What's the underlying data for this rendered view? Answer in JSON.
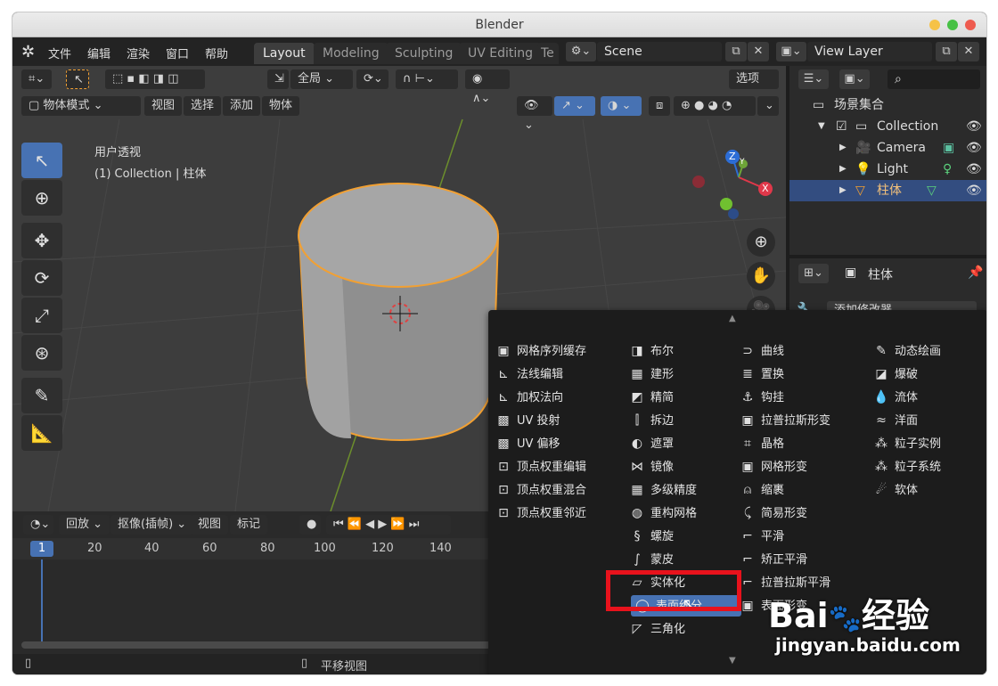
{
  "window": {
    "title": "Blender"
  },
  "topbar": {
    "menus": [
      "文件",
      "编辑",
      "渲染",
      "窗口",
      "帮助"
    ],
    "workspace_tabs": [
      "Layout",
      "Modeling",
      "Sculpting",
      "UV Editing",
      "Te"
    ],
    "scene": "Scene",
    "view_layer": "View Layer"
  },
  "viewport": {
    "transform_orientation": "全局",
    "options_label": "选项",
    "mode": "物体模式",
    "menus": [
      "视图",
      "选择",
      "添加",
      "物体"
    ],
    "overlay_title": "用户透视",
    "overlay_subtitle": "(1) Collection | 柱体",
    "gizmo_axes": {
      "z": "Z",
      "y": "Y",
      "x": "X"
    }
  },
  "outliner": {
    "scene_collection": "场景集合",
    "rows": [
      {
        "name": "Collection",
        "icon": "collection-icon"
      },
      {
        "name": "Camera",
        "icon": "camera-icon"
      },
      {
        "name": "Light",
        "icon": "light-icon"
      },
      {
        "name": "柱体",
        "icon": "mesh-icon",
        "selected": true
      }
    ]
  },
  "properties": {
    "object_name": "柱体",
    "add_modifier": "添加修改器"
  },
  "modifier_menu": {
    "columns": [
      [
        "网格序列缓存",
        "法线编辑",
        "加权法向",
        "UV 投射",
        "UV 偏移",
        "顶点权重编辑",
        "顶点权重混合",
        "顶点权重邻近"
      ],
      [
        "布尔",
        "建形",
        "精简",
        "拆边",
        "遮罩",
        "镜像",
        "多级精度",
        "重构网格",
        "螺旋",
        "蒙皮",
        "实体化",
        "表面细分",
        "三角化"
      ],
      [
        "曲线",
        "置换",
        "钩挂",
        "拉普拉斯形变",
        "晶格",
        "网格形变",
        "缩裹",
        "简易形变",
        "平滑",
        "矫正平滑",
        "拉普拉斯平滑",
        "表面形变"
      ],
      [
        "动态绘画",
        "爆破",
        "流体",
        "洋面",
        "粒子实例",
        "粒子系统",
        "软体"
      ]
    ],
    "highlighted": "表面细分"
  },
  "timeline": {
    "menus": [
      "回放",
      "抠像(插帧)",
      "视图",
      "标记"
    ],
    "current_frame": "1",
    "ticks": [
      "20",
      "40",
      "60",
      "80",
      "100",
      "120",
      "140"
    ]
  },
  "statusbar": {
    "hint": "平移视图"
  },
  "watermark": {
    "brand": "Bai",
    "brand_cn": "经验",
    "url": "jingyan.baidu.com"
  },
  "colors": {
    "accent": "#4772b3",
    "highlight_border": "#e8121c",
    "selection_outline": "#f2a032"
  }
}
